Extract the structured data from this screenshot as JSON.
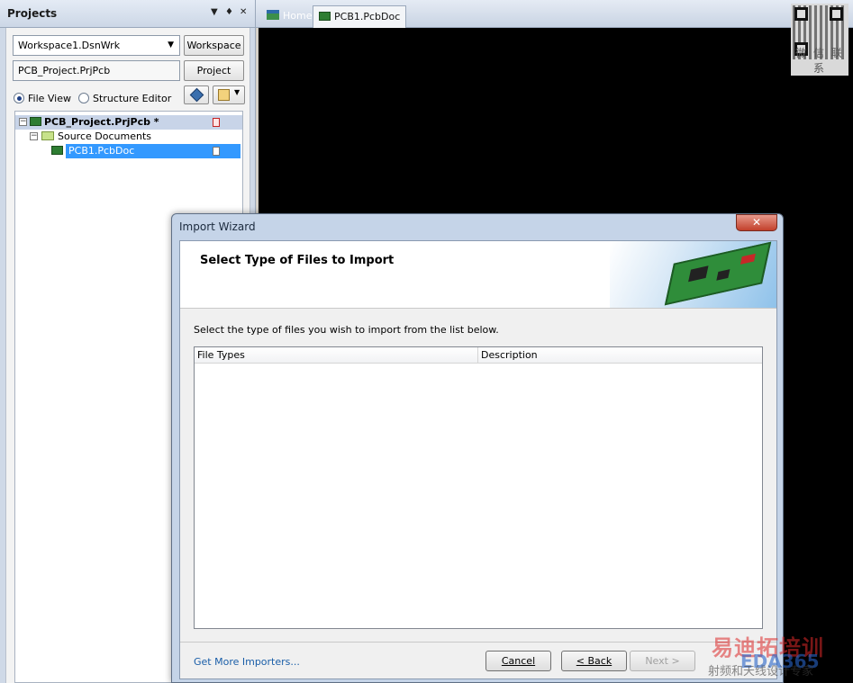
{
  "projects_panel": {
    "title": "Projects",
    "ctrl_menu": "▼",
    "ctrl_pin": "♦",
    "ctrl_close": "✕",
    "workspace_combo": "Workspace1.DsnWrk",
    "workspace_button": "Workspace",
    "project_field": "PCB_Project.PrjPcb",
    "project_button": "Project",
    "view_options": [
      "File View",
      "Structure Editor"
    ],
    "selected_view": "File View",
    "tree": [
      {
        "label": "PCB_Project.PrjPcb *",
        "level": 0,
        "expanded": true,
        "icon": "pcb-project-icon"
      },
      {
        "label": "Source Documents",
        "level": 1,
        "expanded": true,
        "icon": "folder-icon"
      },
      {
        "label": "PCB1.PcbDoc",
        "level": 2,
        "selected": true,
        "icon": "pcb-doc-icon"
      }
    ]
  },
  "tabs": [
    {
      "label": "Home",
      "icon": "home-icon"
    },
    {
      "label": "PCB1.PcbDoc",
      "icon": "pcb-doc-icon",
      "active": true
    }
  ],
  "qr_label": "微 信 联 系",
  "dialog": {
    "title": "Import Wizard",
    "close": "✕",
    "heading": "Select Type of Files to Import",
    "instruction": "Select the type of files you wish to import from the list below.",
    "columns": [
      "File Types",
      "Description"
    ],
    "rows": [],
    "link": "Get More Importers...",
    "buttons": {
      "cancel": "Cancel",
      "back": "< Back",
      "next": "Next >"
    }
  },
  "watermark": {
    "top": "易迪拓培训",
    "middle": "EDA365",
    "bottom": "射频和天线设计专家"
  },
  "colors": {
    "panel_bg": "#cfd9e7",
    "editor_bg": "#000000",
    "selection": "#3399ff",
    "link": "#1a5ea8"
  }
}
